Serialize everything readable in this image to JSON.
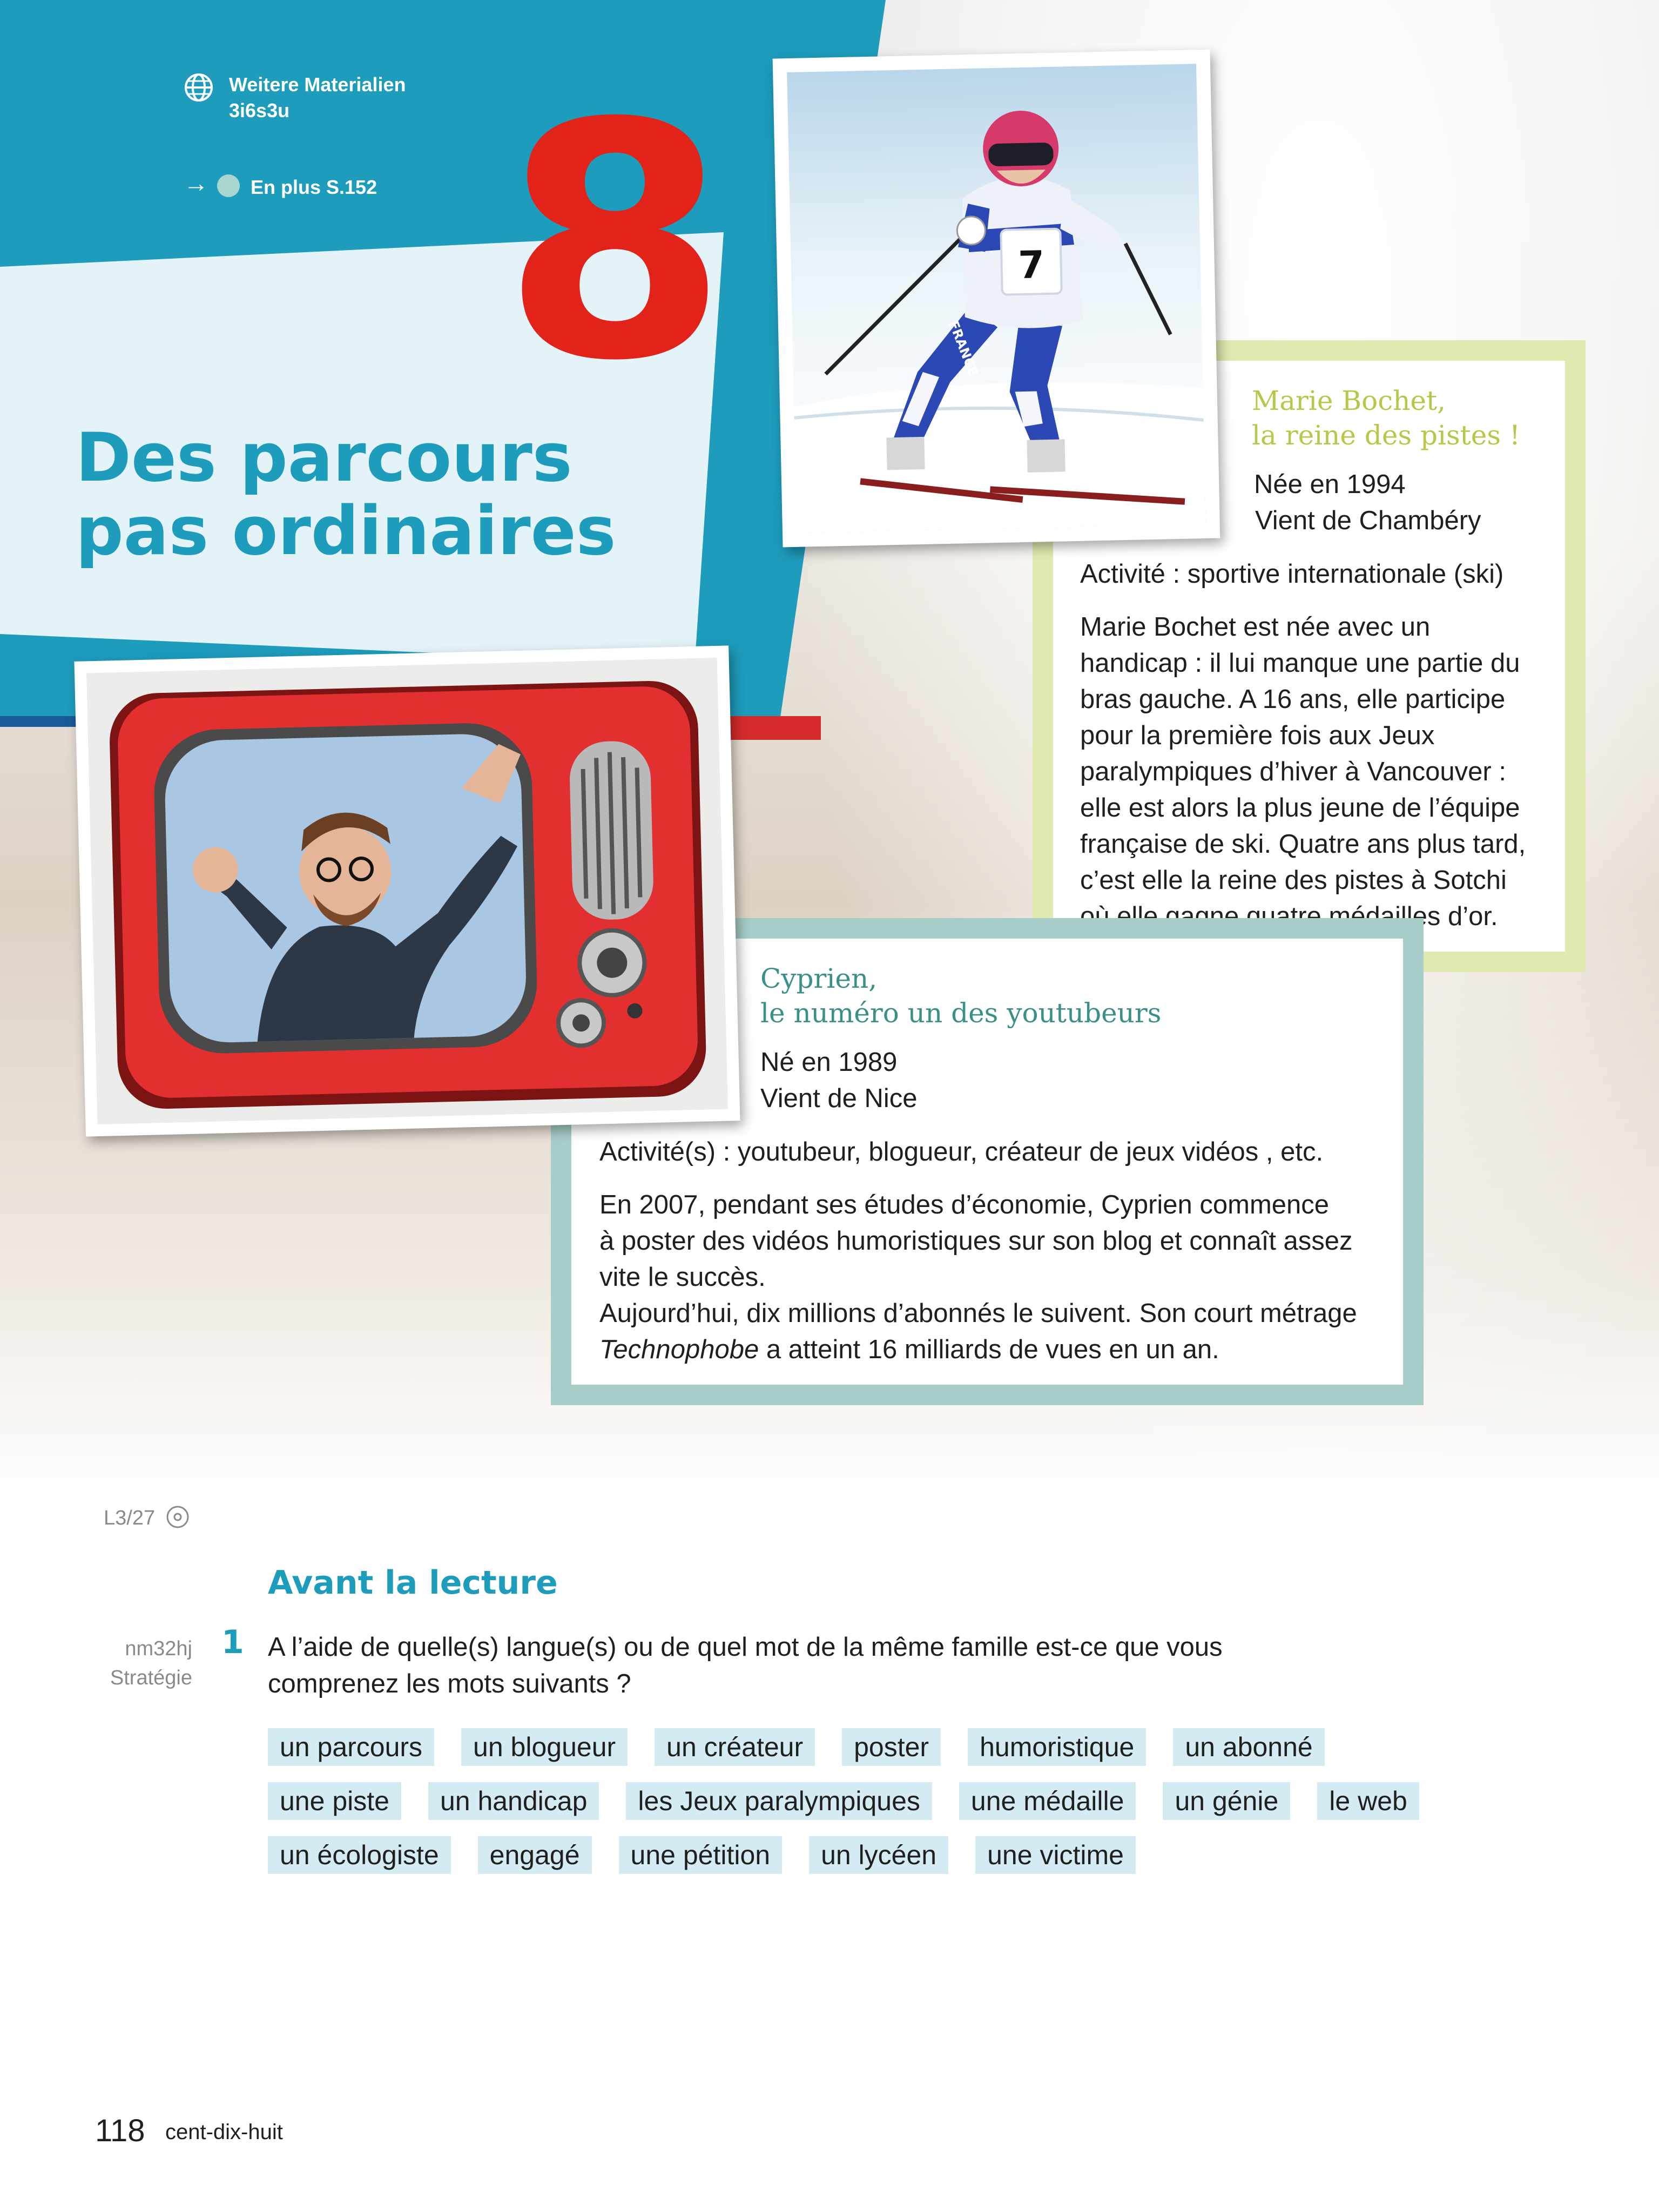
{
  "header": {
    "materials_label": "Weitere Materialien",
    "materials_code": "3i6s3u",
    "arrow": "→",
    "en_plus": "En plus S.152"
  },
  "chapter": {
    "number": "8",
    "title_line1": "Des parcours",
    "title_line2": "pas ordinaires"
  },
  "marie": {
    "title_line1": "Marie Bochet,",
    "title_line2": "la reine des pistes !",
    "born": "Née en 1994",
    "from": "Vient de Chambéry",
    "activity": "Activité : sportive internationale (ski)",
    "bio": [
      "Marie Bochet est née avec un",
      "handicap : il lui manque une partie du",
      "bras gauche. A 16 ans, elle participe",
      "pour la première fois aux Jeux",
      "paralympiques d’hiver à Vancouver :",
      "elle est alors la plus jeune de l’équipe",
      "française de ski. Quatre ans plus tard,",
      "c’est elle la reine des pistes à Sotchi",
      "où elle gagne quatre médailles d’or."
    ]
  },
  "cyprien": {
    "title_line1": "Cyprien,",
    "title_line2": "le numéro un des youtubeurs",
    "born": "Né en 1989",
    "from": "Vient de Nice",
    "activity": "Activité(s) : youtubeur, blogueur, créateur de jeux vidéos , etc.",
    "bio": [
      "En 2007, pendant ses études d’économie, Cyprien commence",
      "à poster des vidéos humoristiques sur son blog et connaît assez",
      "vite le succès.",
      "Aujourd’hui, dix millions d’abonnés le suivent. Son court métrage"
    ],
    "bio_last_italic": "Technophobe",
    "bio_last_rest": " a atteint 16 milliards de vues en un an."
  },
  "photos": {
    "skier_bib": "7",
    "skier_suit_text": "FRANCE"
  },
  "audio": {
    "track": "L3/27"
  },
  "exercise": {
    "section_title": "Avant la lecture",
    "code": "nm32hj",
    "strategy_label": "Stratégie",
    "number": "1",
    "question_line1": "A l’aide de quelle(s) langue(s) ou de quel mot de la même famille est-ce que vous",
    "question_line2": "comprenez les mots suivants ?",
    "words_row1": [
      "un parcours",
      "un blogueur",
      "un créateur",
      "poster",
      "humoristique",
      "un abonné"
    ],
    "words_row2": [
      "une piste",
      "un handicap",
      "les Jeux paralympiques",
      "une médaille",
      "un génie",
      "le web"
    ],
    "words_row3": [
      "un écologiste",
      "engagé",
      "une pétition",
      "un lycéen",
      "une victime"
    ]
  },
  "footer": {
    "page_number": "118",
    "page_words": "cent-dix-huit"
  },
  "colors": {
    "brand_blue": "#1e9cbc",
    "chapter_red": "#e2231a",
    "marie_green": "#b9c64a",
    "cyprien_teal": "#3a8f88",
    "chip_bg": "#d5ebf4"
  }
}
